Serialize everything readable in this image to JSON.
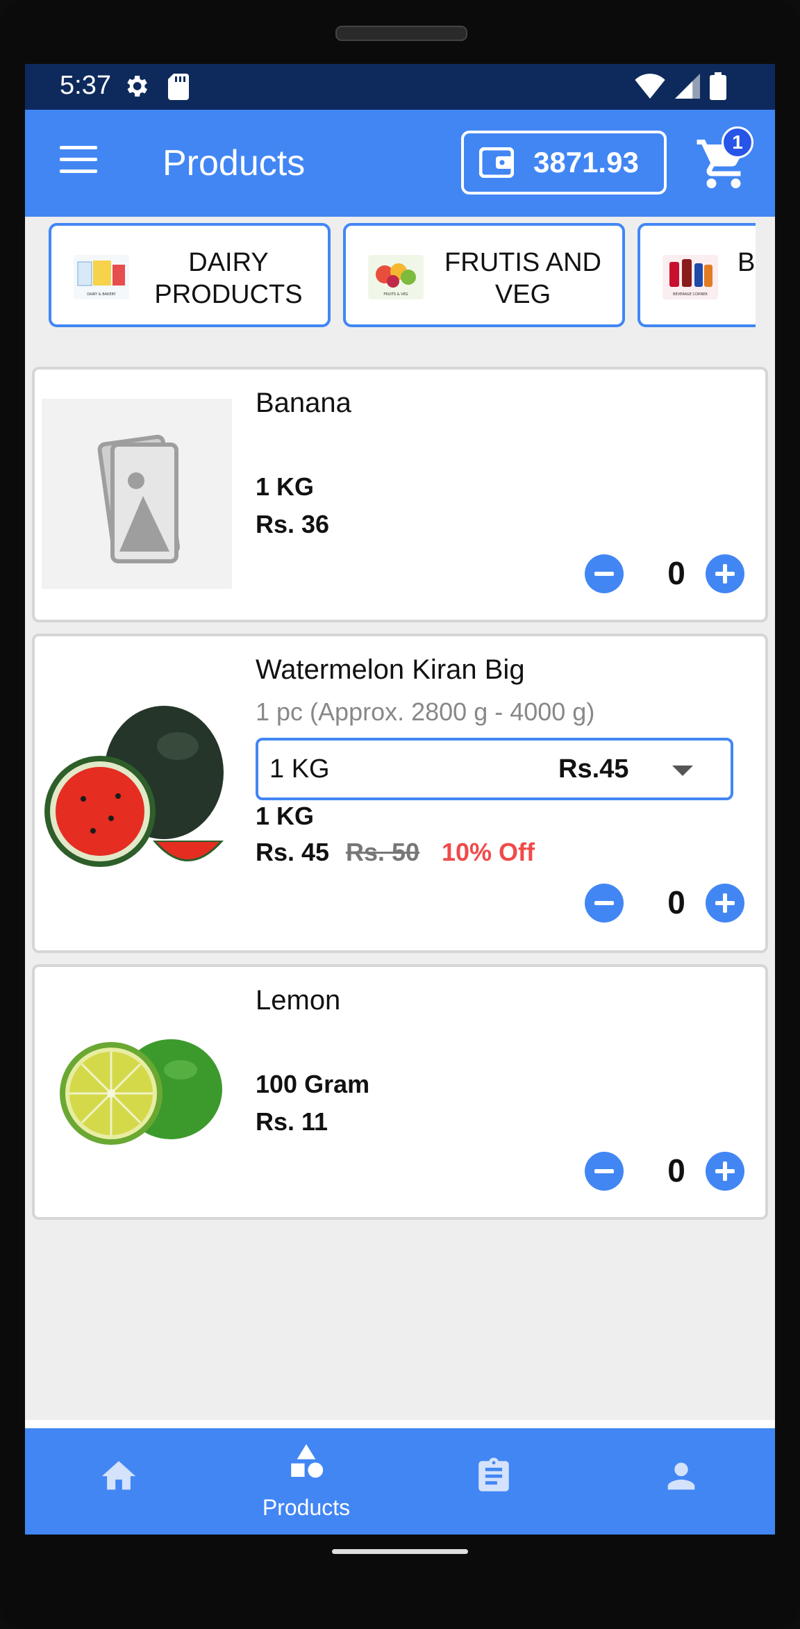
{
  "status_bar": {
    "time": "5:37"
  },
  "app_bar": {
    "title": "Products",
    "wallet_amount": "3871.93",
    "cart_count": "1"
  },
  "categories": [
    {
      "label": "DAIRY PRODUCTS",
      "thumb_label": "DAIRY & BAKERY"
    },
    {
      "label": "FRUTIS AND VEG",
      "thumb_label": "FRUITS & VEG"
    },
    {
      "label": "B",
      "thumb_label": "BEVERAGE CORNER"
    }
  ],
  "products": [
    {
      "name": "Banana",
      "unit": "1 KG",
      "price": "Rs. 36",
      "qty": "0"
    },
    {
      "name": "Watermelon Kiran Big",
      "description": "1 pc (Approx. 2800 g - 4000 g)",
      "variant_unit": "1 KG",
      "variant_price": "Rs.45",
      "unit": "1 KG",
      "price": "Rs. 45",
      "mrp": "Rs. 50",
      "discount": "10% Off",
      "qty": "0"
    },
    {
      "name": "Lemon",
      "unit": "100 Gram",
      "price": "Rs. 11",
      "qty": "0"
    }
  ],
  "bottom_nav": {
    "items": [
      {
        "icon": "home-icon",
        "label": ""
      },
      {
        "icon": "category-shapes-icon",
        "label": "Products"
      },
      {
        "icon": "orders-clipboard-icon",
        "label": ""
      },
      {
        "icon": "profile-icon",
        "label": ""
      }
    ]
  },
  "colors": {
    "primary": "#4286f4",
    "status_bar": "#0e2a5c",
    "discount": "#f04a4a",
    "badge": "#2755e8"
  }
}
